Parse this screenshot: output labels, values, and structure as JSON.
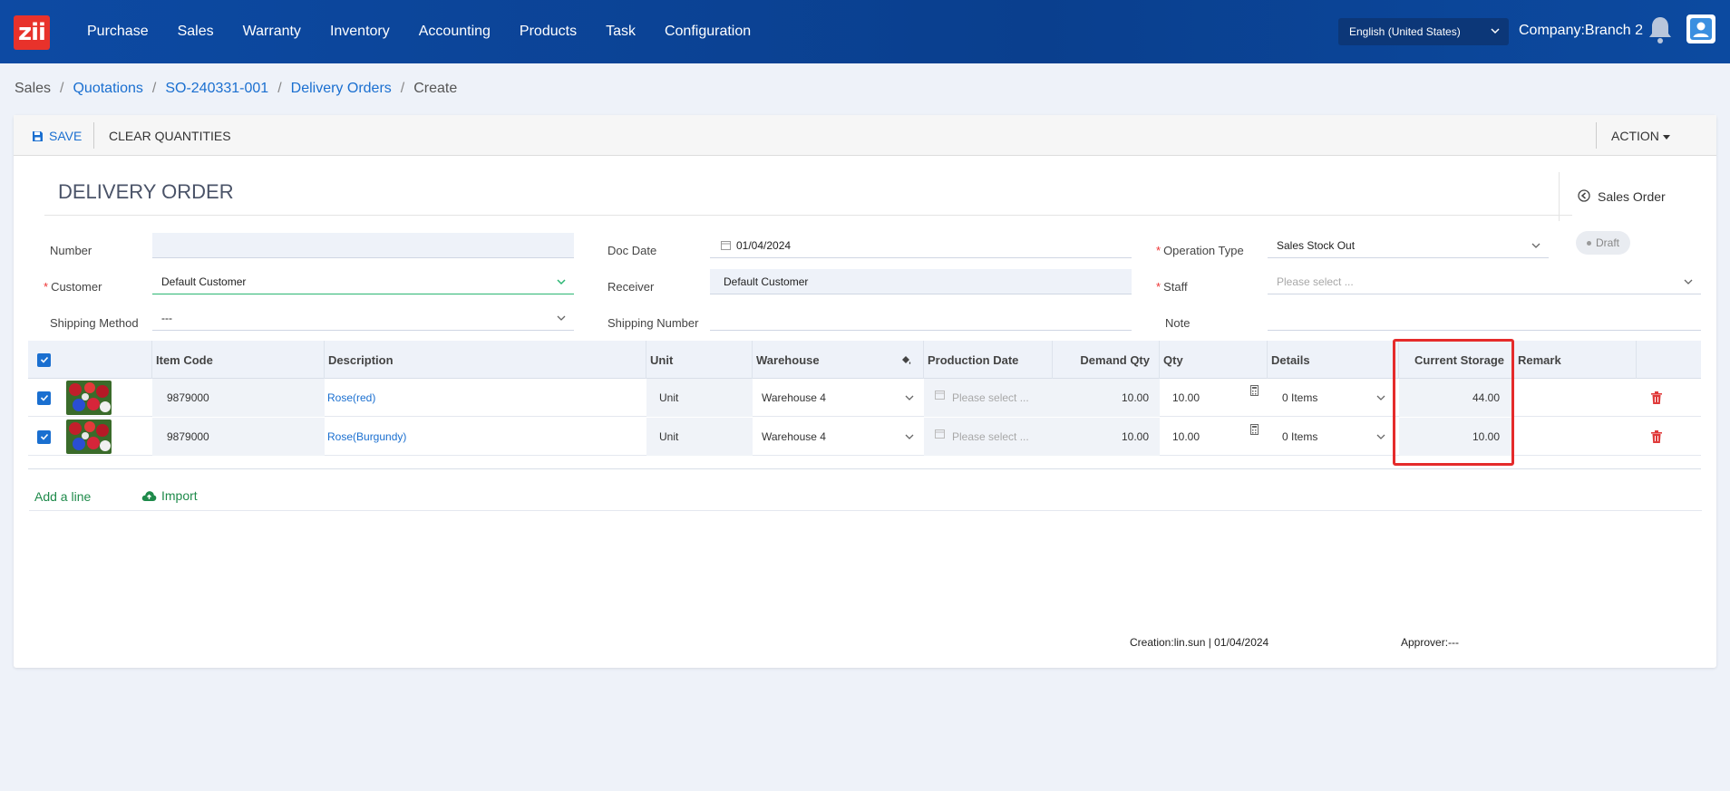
{
  "logo": "zii",
  "nav": [
    "Purchase",
    "Sales",
    "Warranty",
    "Inventory",
    "Accounting",
    "Products",
    "Task",
    "Configuration"
  ],
  "language": "English (United States)",
  "company": "Company:Branch 2",
  "breadcrumb": {
    "items": [
      "Sales",
      "Quotations",
      "SO-240331-001",
      "Delivery Orders",
      "Create"
    ],
    "sep": "/"
  },
  "toolbar": {
    "save": "SAVE",
    "clear": "CLEAR QUANTITIES",
    "action": "ACTION"
  },
  "doc": {
    "title": "DELIVERY ORDER",
    "sales_order_link": "Sales Order",
    "status": "Draft"
  },
  "form": {
    "number_label": "Number",
    "number_value": "",
    "customer_label": "Customer",
    "customer_value": "Default Customer",
    "shipping_method_label": "Shipping Method",
    "shipping_method_value": "---",
    "doc_date_label": "Doc Date",
    "doc_date_value": "01/04/2024",
    "receiver_label": "Receiver",
    "receiver_value": "Default Customer",
    "shipping_number_label": "Shipping Number",
    "shipping_number_value": "",
    "operation_type_label": "Operation Type",
    "operation_type_value": "Sales Stock Out",
    "staff_label": "Staff",
    "staff_placeholder": "Please select ...",
    "note_label": "Note",
    "note_value": ""
  },
  "table": {
    "headers": {
      "item_code": "Item Code",
      "description": "Description",
      "unit": "Unit",
      "warehouse": "Warehouse",
      "production_date": "Production Date",
      "demand_qty": "Demand Qty",
      "qty": "Qty",
      "details": "Details",
      "current_storage": "Current Storage",
      "remark": "Remark"
    },
    "rows": [
      {
        "item_code": "9879000",
        "description": "Rose(red)",
        "unit": "Unit",
        "warehouse": "Warehouse 4",
        "production_date_placeholder": "Please select ...",
        "demand_qty": "10.00",
        "qty": "10.00",
        "details": "0 Items",
        "current_storage": "44.00",
        "remark": ""
      },
      {
        "item_code": "9879000",
        "description": "Rose(Burgundy)",
        "unit": "Unit",
        "warehouse": "Warehouse 4",
        "production_date_placeholder": "Please select ...",
        "demand_qty": "10.00",
        "qty": "10.00",
        "details": "0 Items",
        "current_storage": "10.00",
        "remark": ""
      }
    ],
    "add_line": "Add a line",
    "import": "Import"
  },
  "footer": {
    "creation": "Creation:lin.sun | 01/04/2024",
    "approver": "Approver:---"
  },
  "colors": {
    "nav_bg": "#0d4aa3",
    "link": "#1a6fd0",
    "highlight": "#e52b2b",
    "green": "#1e8a4a"
  }
}
